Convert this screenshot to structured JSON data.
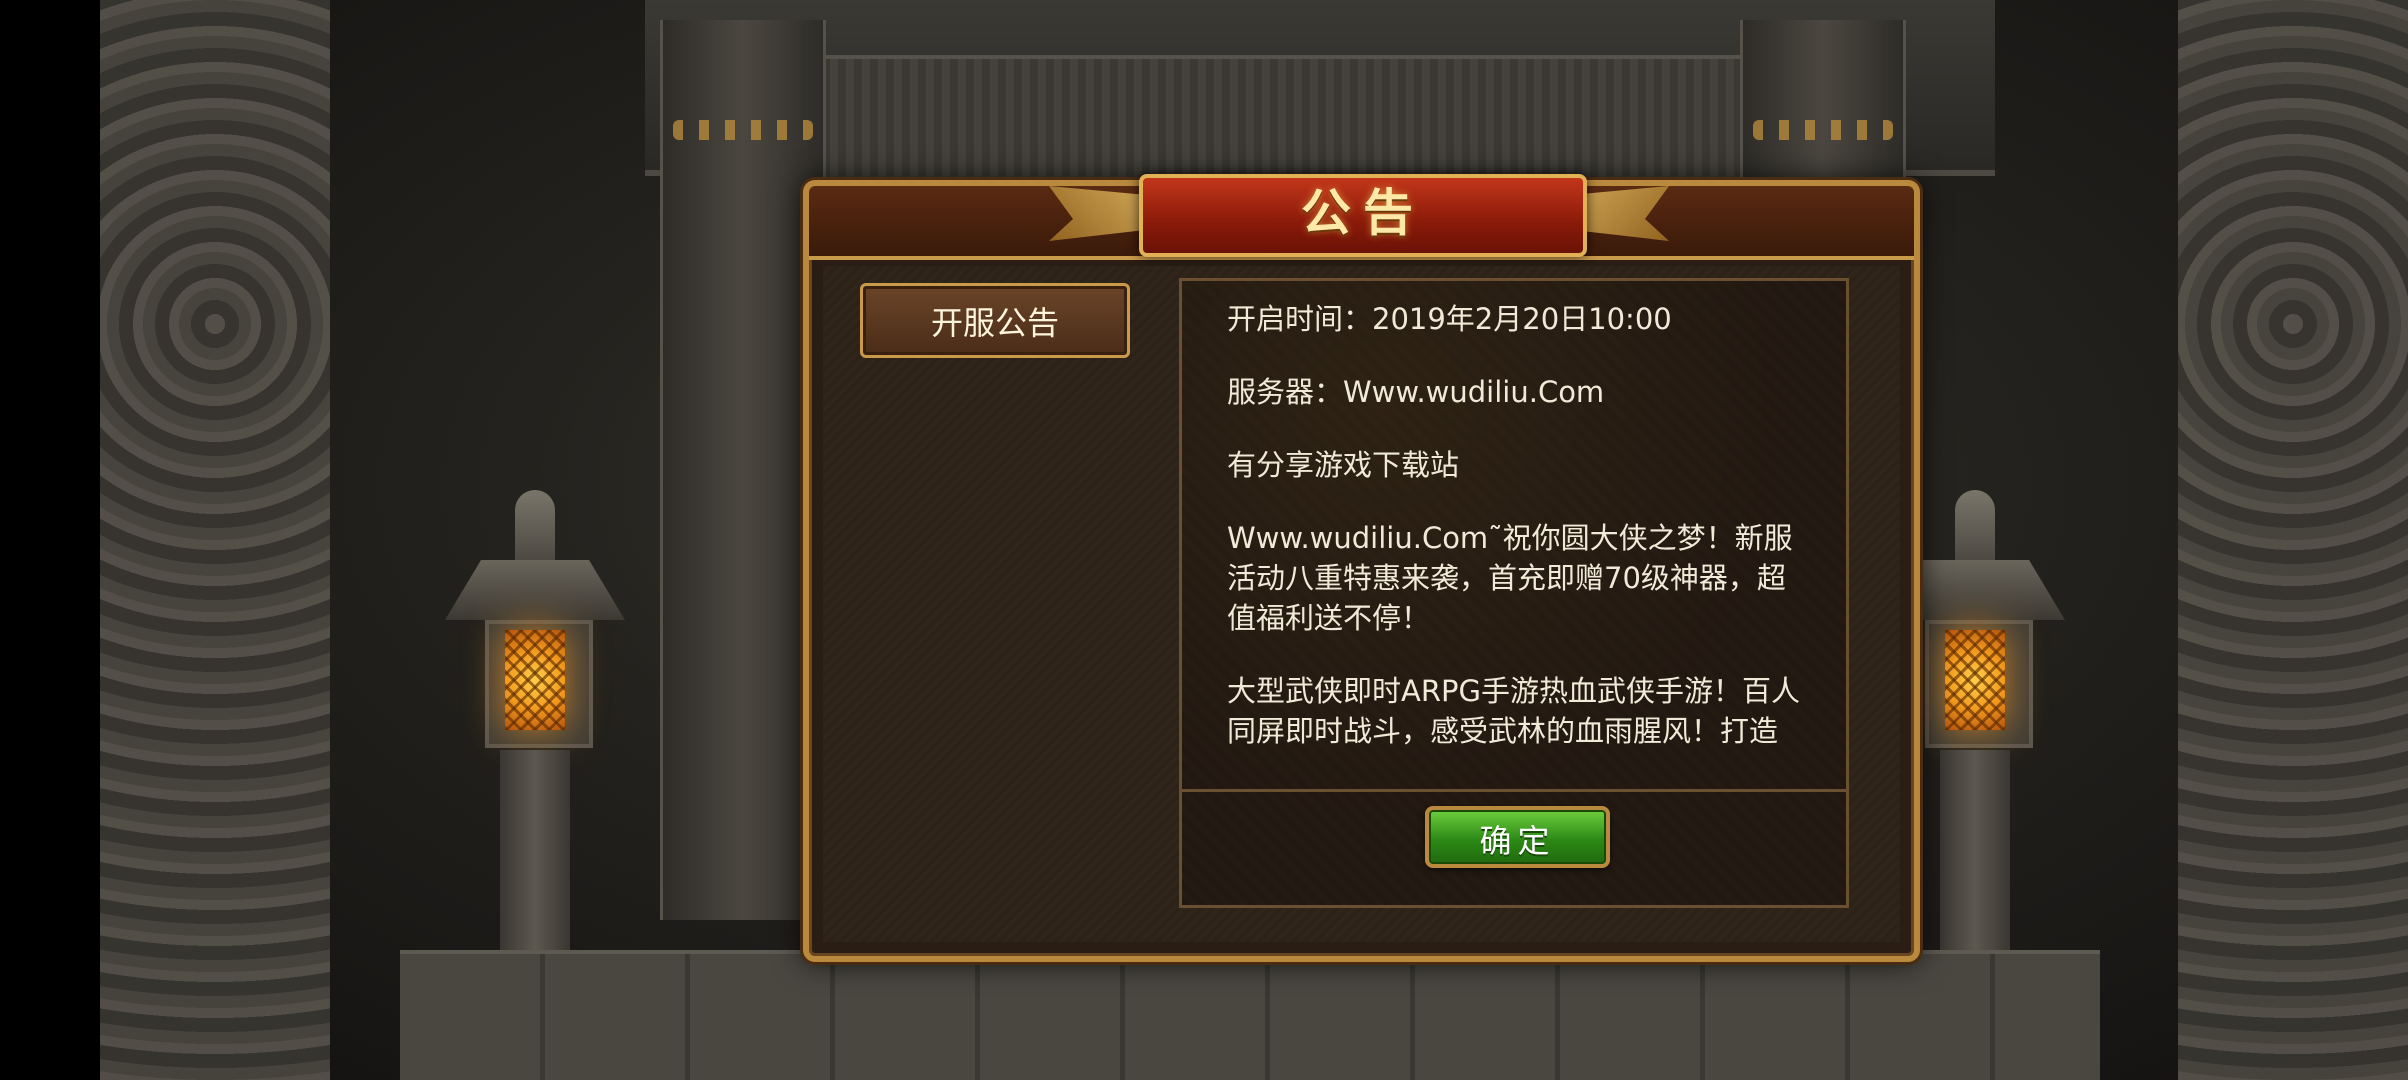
{
  "dialog": {
    "title": "公告",
    "tab_label": "开服公告",
    "content": [
      "开启时间：2019年2月20日10:00",
      "服务器：Www.wudiliu.Com",
      "有分享游戏下载站",
      "Www.wudiliu.Com˜祝你圆大侠之梦！新服活动八重特惠来袭，首充即赠70级神器，超值福利送不停！",
      "大型武侠即时ARPG手游热血武侠手游！百人同屏即时战斗，感受武林的血雨腥风！打造"
    ],
    "confirm_label": "确定"
  },
  "colors": {
    "title_plate": "#8a1a0a",
    "frame_gold": "#b9893d",
    "confirm_green": "#2d8a16",
    "text": "#f2ead8"
  },
  "icons": [
    "lantern-icon",
    "dragon-column-icon"
  ]
}
